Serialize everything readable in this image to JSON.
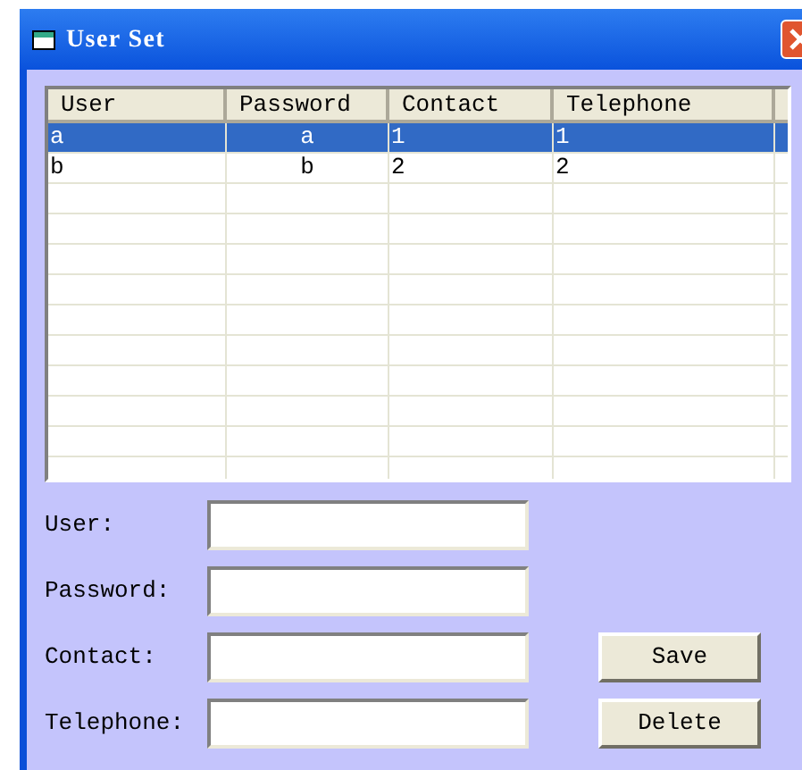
{
  "window": {
    "title": "User Set"
  },
  "table": {
    "columns": [
      "User",
      "Password",
      "Contact",
      "Telephone"
    ],
    "rows": [
      {
        "cells": [
          "a",
          "a",
          "1",
          "1"
        ],
        "selected": true
      },
      {
        "cells": [
          "b",
          "b",
          "2",
          "2"
        ],
        "selected": false
      }
    ]
  },
  "form": {
    "fields": [
      {
        "label": "User:"
      },
      {
        "label": "Password:"
      },
      {
        "label": "Contact:"
      },
      {
        "label": "Telephone:"
      }
    ]
  },
  "buttons": [
    "Save",
    "Delete"
  ]
}
